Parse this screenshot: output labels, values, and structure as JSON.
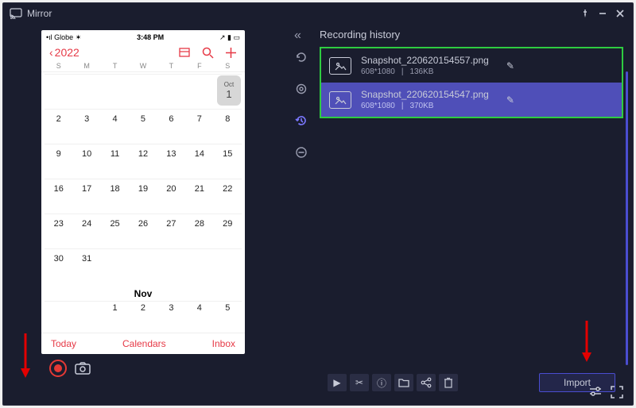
{
  "app": {
    "title": "Mirror"
  },
  "phone": {
    "status": {
      "carrier": "Globe",
      "time": "3:48 PM"
    },
    "calendar": {
      "year": "2022",
      "days_short": [
        "S",
        "M",
        "T",
        "W",
        "T",
        "F",
        "S"
      ],
      "oct_label": "Oct",
      "oct_day": "1",
      "nov_label": "Nov",
      "footer": {
        "today": "Today",
        "calendars": "Calendars",
        "inbox": "Inbox"
      }
    }
  },
  "history": {
    "title": "Recording history",
    "items": [
      {
        "name": "Snapshot_220620154557.png",
        "dims": "608*1080",
        "size": "136KB"
      },
      {
        "name": "Snapshot_220620154547.png",
        "dims": "608*1080",
        "size": "370KB"
      }
    ],
    "import_label": "Import"
  }
}
